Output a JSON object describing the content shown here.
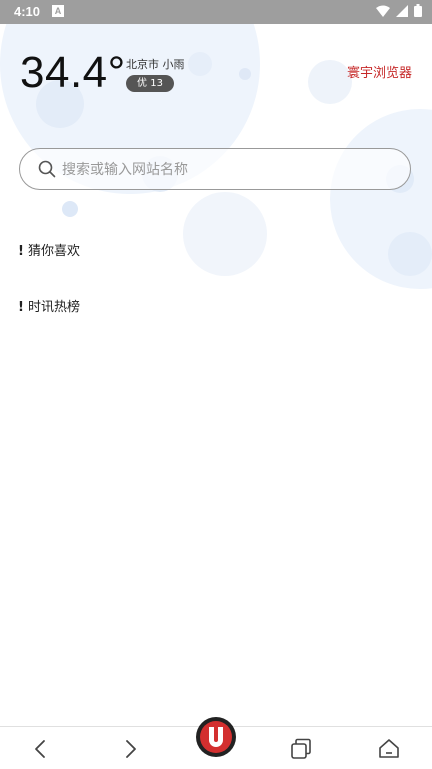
{
  "status_bar": {
    "time": "4:10",
    "notification_icon": "A"
  },
  "weather": {
    "temperature": "34.4°",
    "city_condition": "北京市 小雨",
    "aqi_badge": "优   13"
  },
  "brand": {
    "name": "寰宇浏览器",
    "color": "#c62828"
  },
  "search": {
    "placeholder": "搜索或输入网站名称",
    "value": ""
  },
  "sections": {
    "guess": "猜你喜欢",
    "hot": "时讯热榜",
    "marker": "!"
  },
  "bottom_nav": {
    "back_icon": "chevron-left-icon",
    "forward_icon": "chevron-right-icon",
    "home_logo": "u-logo-icon",
    "tabs_icon": "tabs-icon",
    "home_icon": "home-icon"
  }
}
